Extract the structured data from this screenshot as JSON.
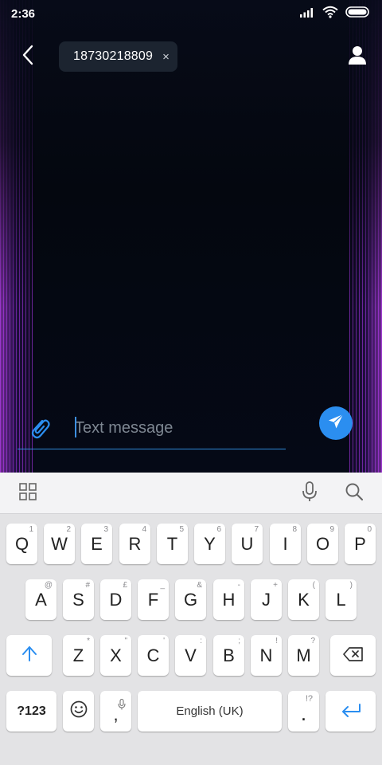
{
  "status_bar": {
    "time": "2:36",
    "icons": [
      "signal-icon",
      "wifi-icon",
      "battery-icon"
    ]
  },
  "header": {
    "recipient": "18730218809",
    "chip_remove": "×",
    "icons": [
      "back-arrow-icon",
      "contact-person-icon"
    ]
  },
  "compose": {
    "placeholder": "Text message",
    "value": "",
    "icons": [
      "paperclip-icon",
      "send-paper-plane-icon"
    ]
  },
  "keyboard": {
    "toolbar_icons": [
      "grid-menu-icon",
      "microphone-icon",
      "search-icon"
    ],
    "row1": [
      {
        "key": "Q",
        "hint": "1"
      },
      {
        "key": "W",
        "hint": "2"
      },
      {
        "key": "E",
        "hint": "3"
      },
      {
        "key": "R",
        "hint": "4"
      },
      {
        "key": "T",
        "hint": "5"
      },
      {
        "key": "Y",
        "hint": "6"
      },
      {
        "key": "U",
        "hint": "7"
      },
      {
        "key": "I",
        "hint": "8"
      },
      {
        "key": "O",
        "hint": "9"
      },
      {
        "key": "P",
        "hint": "0"
      }
    ],
    "row2": [
      {
        "key": "A",
        "hint": "@"
      },
      {
        "key": "S",
        "hint": "#"
      },
      {
        "key": "D",
        "hint": "£"
      },
      {
        "key": "F",
        "hint": "_"
      },
      {
        "key": "G",
        "hint": "&"
      },
      {
        "key": "H",
        "hint": "-"
      },
      {
        "key": "J",
        "hint": "+"
      },
      {
        "key": "K",
        "hint": "("
      },
      {
        "key": "L",
        "hint": ")"
      }
    ],
    "row3": [
      {
        "key": "Z",
        "hint": "*"
      },
      {
        "key": "X",
        "hint": "\""
      },
      {
        "key": "C",
        "hint": "'"
      },
      {
        "key": "V",
        "hint": ":"
      },
      {
        "key": "B",
        "hint": ";"
      },
      {
        "key": "N",
        "hint": "!"
      },
      {
        "key": "M",
        "hint": "?"
      }
    ],
    "symbols_label": "?123",
    "comma_label": ",",
    "space_label": "English (UK)",
    "period_label": ".",
    "period_hint": "!?",
    "special_icons": [
      "shift-arrow-icon",
      "backspace-icon",
      "emoji-icon",
      "comma-mic-icon",
      "enter-arrow-icon"
    ]
  },
  "colors": {
    "accent": "#2b8ef0",
    "glow": "#c846ff",
    "chat_bg": "#050916",
    "keyboard_bg": "#e3e3e5"
  }
}
